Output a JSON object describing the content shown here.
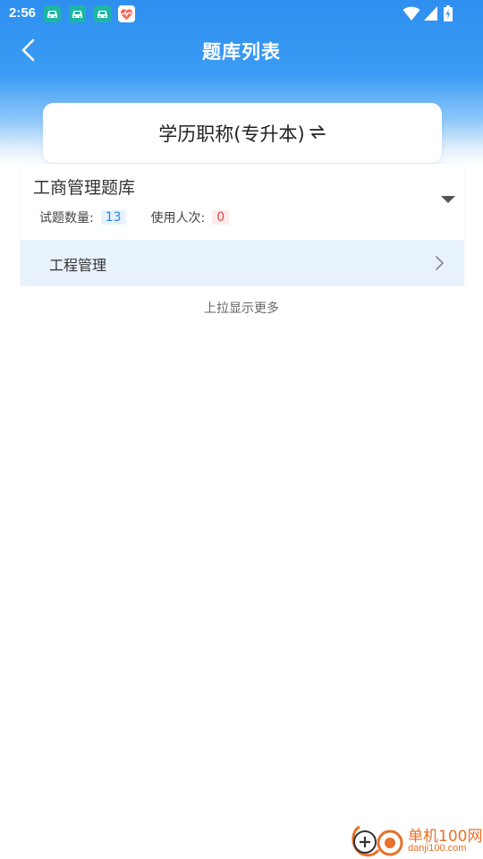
{
  "status_bar": {
    "time": "2:56",
    "notifications": [
      "car-app-icon",
      "car-app-icon",
      "car-app-icon",
      "health-app-icon"
    ],
    "system_icons": [
      "wifi-icon",
      "signal-icon",
      "battery-charging-icon"
    ]
  },
  "header": {
    "title": "题库列表",
    "back_icon": "chevron-left-icon"
  },
  "category_selector": {
    "label": "学历职称(专升本)",
    "switch_icon": "swap-arrows-icon"
  },
  "question_bank": {
    "title": "工商管理题库",
    "count_label": "试题数量:",
    "count_value": "13",
    "usage_label": "使用人次:",
    "usage_value": "0",
    "expand_icon": "triangle-down-icon",
    "items": [
      {
        "label": "工程管理",
        "icon": "chevron-right-icon"
      }
    ]
  },
  "load_more": "上拉显示更多",
  "watermark": {
    "name": "单机100网",
    "url": "danji100.com"
  },
  "colors": {
    "header_gradient_top": "#2f8ff0",
    "accent_blue": "#2b86e6",
    "badge_red": "#e64545",
    "sub_item_bg": "#e7f2fd",
    "watermark_orange": "#e8702a"
  }
}
